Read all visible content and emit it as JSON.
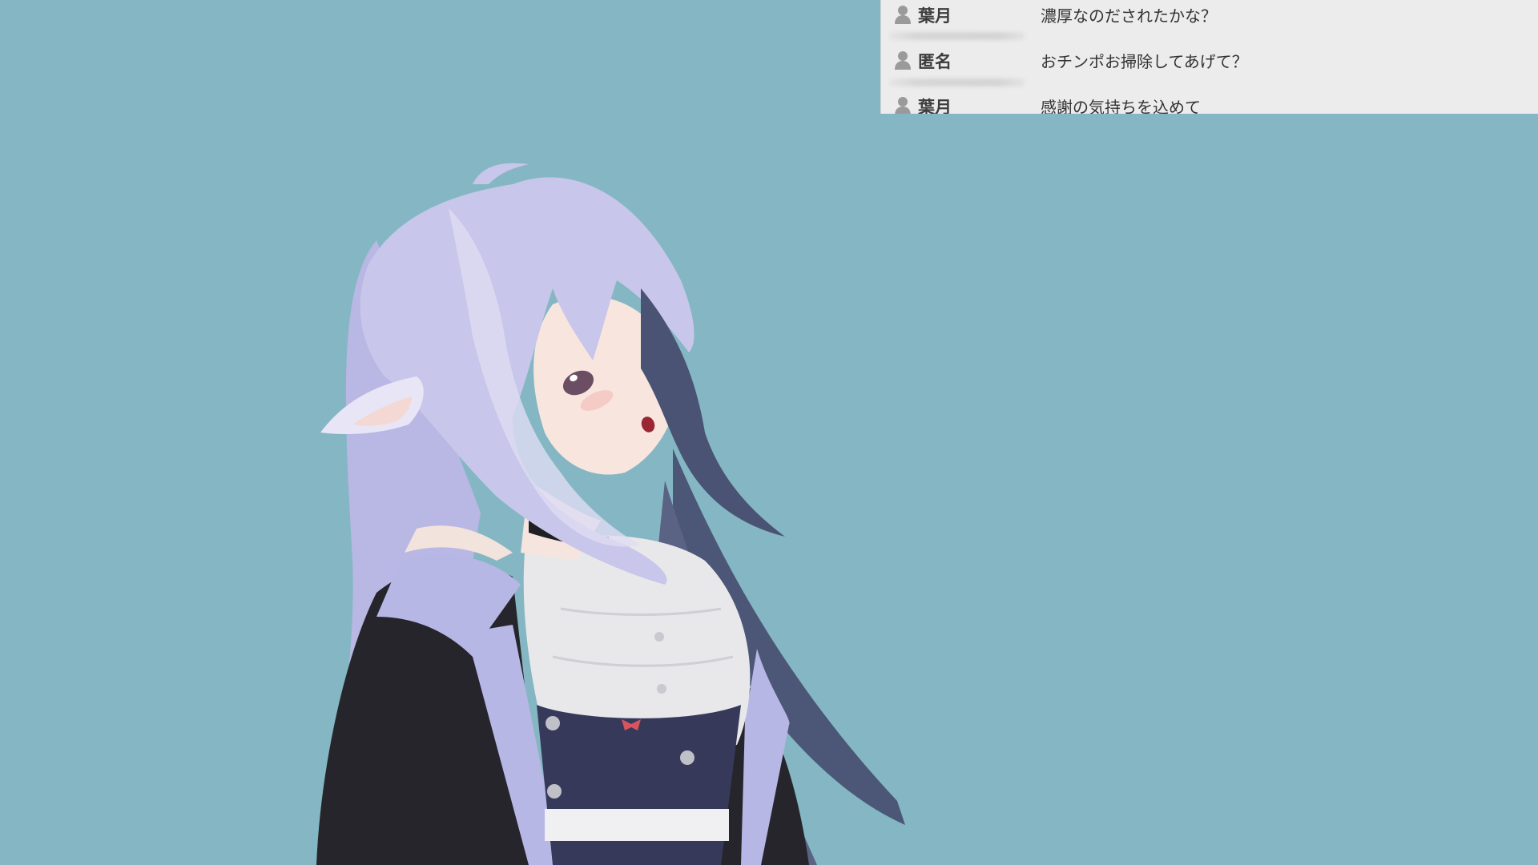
{
  "colors": {
    "background": "#84b7c3",
    "chat_panel": "#ececec",
    "hair": "#c8c6ea",
    "hair_shadow": "#4a5374",
    "jacket_dark": "#26252b",
    "jacket_lapel": "#b7b7e6",
    "shirt": "#e8e8ea",
    "vest": "#37395a"
  },
  "chat": {
    "messages": [
      {
        "user": "葉月",
        "text": "濃厚なのだされたかな？",
        "icon": "user-icon"
      },
      {
        "user": "匿名",
        "text": "おチンポお掃除してあげて？",
        "icon": "user-icon"
      },
      {
        "user": "葉月",
        "text": "感謝の気持ちを込めて",
        "icon": "user-icon"
      }
    ]
  },
  "avatar": {
    "description_icon": "vtuber-avatar"
  }
}
